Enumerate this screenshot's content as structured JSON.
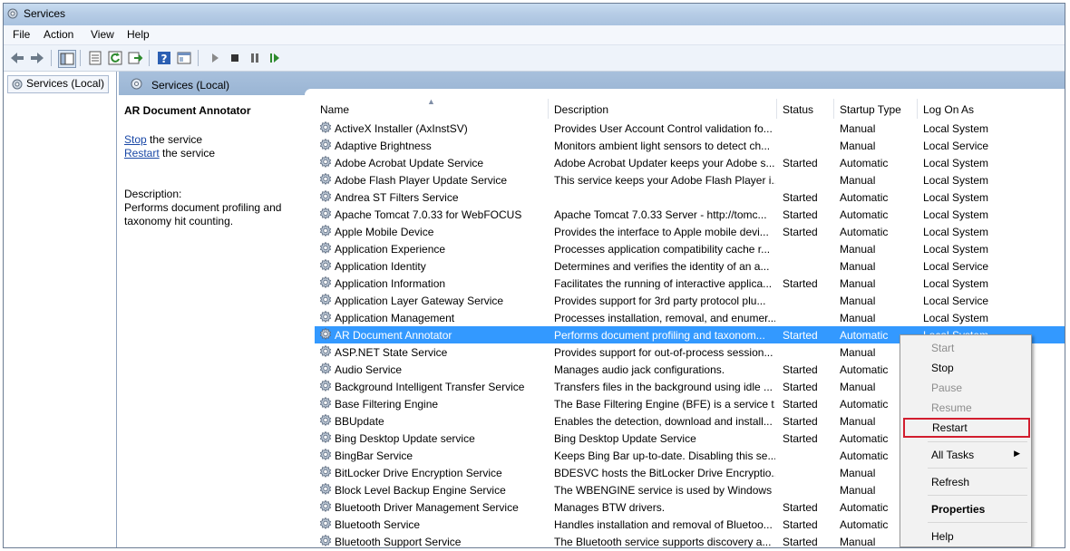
{
  "window": {
    "title": "Services"
  },
  "menu": [
    "File",
    "Action",
    "View",
    "Help"
  ],
  "tree": {
    "root": "Services (Local)"
  },
  "pane": {
    "header": "Services (Local)"
  },
  "details": {
    "title": "AR Document Annotator",
    "stop_link": "Stop",
    "stop_suffix": " the service",
    "restart_link": "Restart",
    "restart_suffix": " the service",
    "desc_label": "Description:",
    "desc_text": "Performs document profiling and taxonomy hit counting."
  },
  "columns": [
    "Name",
    "Description",
    "Status",
    "Startup Type",
    "Log On As"
  ],
  "rows": [
    {
      "name": "ActiveX Installer (AxInstSV)",
      "desc": "Provides User Account Control validation fo...",
      "status": "",
      "startup": "Manual",
      "logon": "Local System"
    },
    {
      "name": "Adaptive Brightness",
      "desc": "Monitors ambient light sensors to detect ch...",
      "status": "",
      "startup": "Manual",
      "logon": "Local Service"
    },
    {
      "name": "Adobe Acrobat Update Service",
      "desc": "Adobe Acrobat Updater keeps your Adobe s...",
      "status": "Started",
      "startup": "Automatic",
      "logon": "Local System"
    },
    {
      "name": "Adobe Flash Player Update Service",
      "desc": "This service keeps your Adobe Flash Player i...",
      "status": "",
      "startup": "Manual",
      "logon": "Local System"
    },
    {
      "name": "Andrea ST Filters Service",
      "desc": "",
      "status": "Started",
      "startup": "Automatic",
      "logon": "Local System"
    },
    {
      "name": "Apache Tomcat 7.0.33 for WebFOCUS",
      "desc": "Apache Tomcat 7.0.33 Server - http://tomc...",
      "status": "Started",
      "startup": "Automatic",
      "logon": "Local System"
    },
    {
      "name": "Apple Mobile Device",
      "desc": "Provides the interface to Apple mobile devi...",
      "status": "Started",
      "startup": "Automatic",
      "logon": "Local System"
    },
    {
      "name": "Application Experience",
      "desc": "Processes application compatibility cache r...",
      "status": "",
      "startup": "Manual",
      "logon": "Local System"
    },
    {
      "name": "Application Identity",
      "desc": "Determines and verifies the identity of an a...",
      "status": "",
      "startup": "Manual",
      "logon": "Local Service"
    },
    {
      "name": "Application Information",
      "desc": "Facilitates the running of interactive applica...",
      "status": "Started",
      "startup": "Manual",
      "logon": "Local System"
    },
    {
      "name": "Application Layer Gateway Service",
      "desc": "Provides support for 3rd party protocol plu...",
      "status": "",
      "startup": "Manual",
      "logon": "Local Service"
    },
    {
      "name": "Application Management",
      "desc": "Processes installation, removal, and enumer...",
      "status": "",
      "startup": "Manual",
      "logon": "Local System"
    },
    {
      "name": "AR Document Annotator",
      "desc": "Performs document profiling and taxonom...",
      "status": "Started",
      "startup": "Automatic",
      "logon": "Local System",
      "selected": true
    },
    {
      "name": "ASP.NET State Service",
      "desc": "Provides support for out-of-process session...",
      "status": "",
      "startup": "Manual",
      "logon": ""
    },
    {
      "name": "Audio Service",
      "desc": "Manages audio jack configurations.",
      "status": "Started",
      "startup": "Automatic",
      "logon": ""
    },
    {
      "name": "Background Intelligent Transfer Service",
      "desc": "Transfers files in the background using idle ...",
      "status": "Started",
      "startup": "Manual",
      "logon": ""
    },
    {
      "name": "Base Filtering Engine",
      "desc": "The Base Filtering Engine (BFE) is a service t...",
      "status": "Started",
      "startup": "Automatic",
      "logon": ""
    },
    {
      "name": "BBUpdate",
      "desc": "Enables the detection, download and install...",
      "status": "Started",
      "startup": "Manual",
      "logon": ""
    },
    {
      "name": "Bing Desktop Update service",
      "desc": "Bing Desktop Update Service",
      "status": "Started",
      "startup": "Automatic",
      "logon": ""
    },
    {
      "name": "BingBar Service",
      "desc": "Keeps Bing Bar up-to-date. Disabling this se...",
      "status": "",
      "startup": "Automatic",
      "logon": ""
    },
    {
      "name": "BitLocker Drive Encryption Service",
      "desc": "BDESVC hosts the BitLocker Drive Encryptio...",
      "status": "",
      "startup": "Manual",
      "logon": ""
    },
    {
      "name": "Block Level Backup Engine Service",
      "desc": "The WBENGINE service is used by Windows ...",
      "status": "",
      "startup": "Manual",
      "logon": ""
    },
    {
      "name": "Bluetooth Driver Management Service",
      "desc": "Manages BTW drivers.",
      "status": "Started",
      "startup": "Automatic",
      "logon": ""
    },
    {
      "name": "Bluetooth Service",
      "desc": "Handles installation and removal of Bluetoo...",
      "status": "Started",
      "startup": "Automatic",
      "logon": ""
    },
    {
      "name": "Bluetooth Support Service",
      "desc": "The Bluetooth service supports discovery a...",
      "status": "Started",
      "startup": "Manual",
      "logon": ""
    }
  ],
  "context_menu": [
    {
      "label": "Start",
      "state": "disabled"
    },
    {
      "label": "Stop",
      "state": "enabled"
    },
    {
      "label": "Pause",
      "state": "disabled"
    },
    {
      "label": "Resume",
      "state": "disabled"
    },
    {
      "label": "Restart",
      "state": "highlighted"
    },
    {
      "label": "All Tasks",
      "state": "submenu"
    },
    {
      "label": "Refresh",
      "state": "enabled"
    },
    {
      "label": "Properties",
      "state": "bold"
    },
    {
      "label": "Help",
      "state": "enabled"
    }
  ],
  "colors": {
    "selection": "#3399ff",
    "header_band": "#a8c0dc",
    "highlight_border": "#d21d2e",
    "link": "#1a48a6"
  },
  "icons": [
    "services-icon",
    "back-arrow-icon",
    "forward-arrow-icon",
    "console-tree-icon",
    "export-list-icon",
    "refresh-icon",
    "export-icon",
    "help-icon",
    "properties-icon",
    "play-icon",
    "stop-icon",
    "pause-icon",
    "restart-icon",
    "gear-icon",
    "submenu-arrow-icon"
  ]
}
